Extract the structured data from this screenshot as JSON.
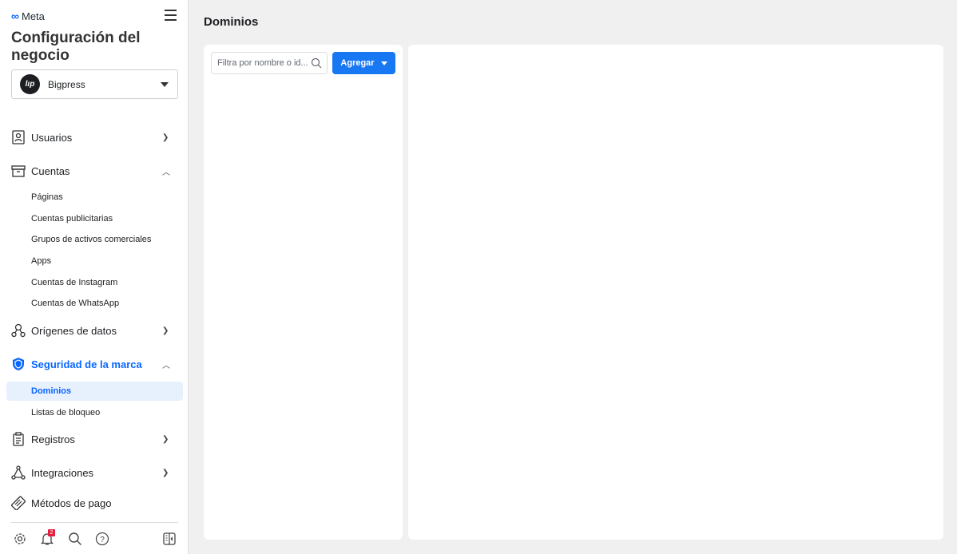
{
  "brand": "Meta",
  "title": "Configuración del negocio",
  "business": {
    "name": "Bigpress",
    "initials": "lıp"
  },
  "nav": [
    {
      "label": "Usuarios",
      "icon": "users-icon",
      "expanded": false
    },
    {
      "label": "Cuentas",
      "icon": "accounts-icon",
      "expanded": true,
      "children": [
        "Páginas",
        "Cuentas publicitarias",
        "Grupos de activos comerciales",
        "Apps",
        "Cuentas de Instagram",
        "Cuentas de WhatsApp"
      ]
    },
    {
      "label": "Orígenes de datos",
      "icon": "data-sources-icon",
      "expanded": false
    },
    {
      "label": "Seguridad de la marca",
      "icon": "shield-icon",
      "expanded": true,
      "active": true,
      "children": [
        "Dominios",
        "Listas de bloqueo"
      ]
    },
    {
      "label": "Registros",
      "icon": "clipboard-icon",
      "expanded": false
    },
    {
      "label": "Integraciones",
      "icon": "integrations-icon",
      "expanded": false
    },
    {
      "label": "Métodos de pago",
      "icon": "credit-card-icon"
    }
  ],
  "footer": {
    "notifications": "2"
  },
  "main": {
    "title": "Dominios",
    "search_placeholder": "Filtra por nombre o id...",
    "add_label": "Agregar"
  },
  "colors": {
    "accent": "#0866ff",
    "button": "#1877f2",
    "badge": "#e41e3f"
  }
}
